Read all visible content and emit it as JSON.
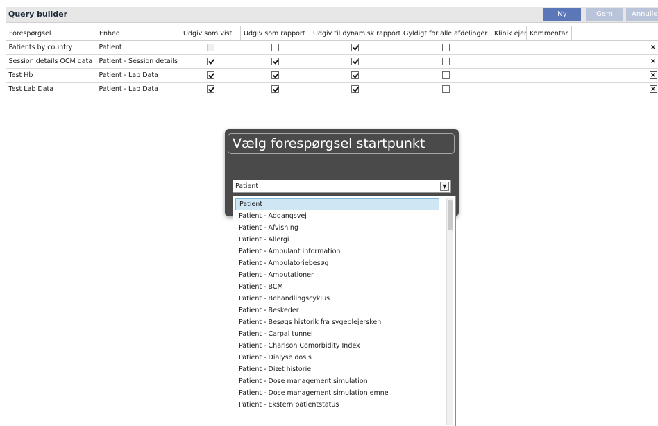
{
  "header": {
    "title": "Query builder",
    "buttons": {
      "new": "Ny",
      "save": "Gem",
      "cancel": "Annuller"
    }
  },
  "grid": {
    "columns": [
      "Forespørgsel",
      "Enhed",
      "Udgiv som vist",
      "Udgiv som rapport",
      "Udgiv til dynamisk rapport",
      "Gyldigt for alle afdelinger",
      "Klinik ejer",
      "Kommentar"
    ],
    "rows": [
      {
        "query": "Patients by country",
        "entity": "Patient",
        "publish_view": "disabled",
        "publish_report": false,
        "publish_dynamic": true,
        "valid_all": false
      },
      {
        "query": "Session details OCM data",
        "entity": "Patient - Session details",
        "publish_view": true,
        "publish_report": true,
        "publish_dynamic": true,
        "valid_all": false
      },
      {
        "query": "Test Hb",
        "entity": "Patient - Lab Data",
        "publish_view": true,
        "publish_report": true,
        "publish_dynamic": true,
        "valid_all": false
      },
      {
        "query": "Test Lab Data",
        "entity": "Patient - Lab Data",
        "publish_view": true,
        "publish_report": true,
        "publish_dynamic": true,
        "valid_all": false
      }
    ],
    "delete_glyph": "×"
  },
  "dialog": {
    "title": "Vælg forespørgsel startpunkt",
    "select_value": "Patient",
    "options": [
      "Patient",
      "Patient - Adgangsvej",
      "Patient - Afvisning",
      "Patient - Allergi",
      "Patient - Ambulant information",
      "Patient - Ambulatoriebesøg",
      "Patient - Amputationer",
      "Patient - BCM",
      "Patient - Behandlingscyklus",
      "Patient - Beskeder",
      "Patient - Besøgs historik fra sygeplejersken",
      "Patient - Carpal tunnel",
      "Patient - Charlson Comorbidity Index",
      "Patient - Dialyse dosis",
      "Patient - Diæt historie",
      "Patient - Dose management simulation",
      "Patient - Dose management simulation emne",
      "Patient - Ekstern patientstatus"
    ],
    "selected_index": 0
  }
}
